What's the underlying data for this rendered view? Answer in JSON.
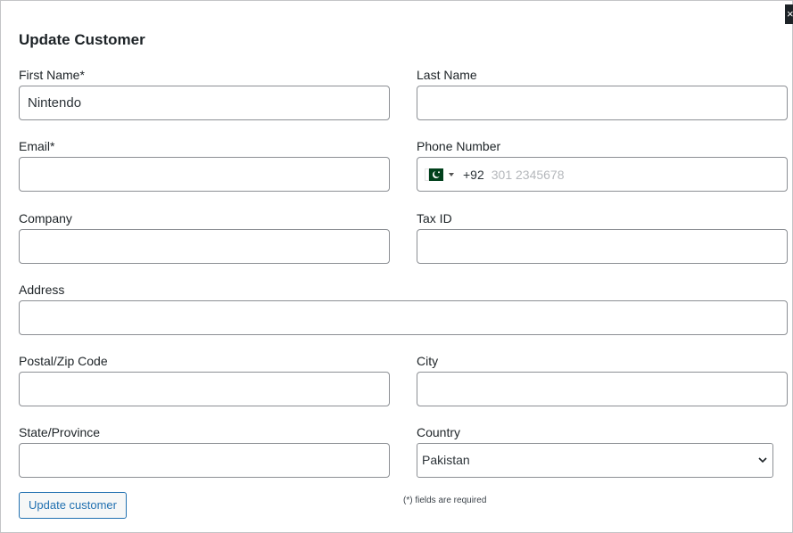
{
  "modal": {
    "title": "Update Customer",
    "close_icon": "close-icon"
  },
  "form": {
    "first_name": {
      "label": "First Name*",
      "value": "Nintendo"
    },
    "last_name": {
      "label": "Last Name",
      "value": ""
    },
    "email": {
      "label": "Email*",
      "value": ""
    },
    "phone": {
      "label": "Phone Number",
      "flag": "pakistan-flag-icon",
      "dial_code": "+92",
      "placeholder": "301 2345678"
    },
    "company": {
      "label": "Company",
      "value": ""
    },
    "tax_id": {
      "label": "Tax ID",
      "value": ""
    },
    "address": {
      "label": "Address",
      "value": ""
    },
    "postal": {
      "label": "Postal/Zip Code",
      "value": ""
    },
    "city": {
      "label": "City",
      "value": ""
    },
    "state": {
      "label": "State/Province",
      "value": ""
    },
    "country": {
      "label": "Country",
      "selected": "Pakistan"
    }
  },
  "actions": {
    "submit_label": "Update customer",
    "required_note": "(*) fields are required"
  }
}
